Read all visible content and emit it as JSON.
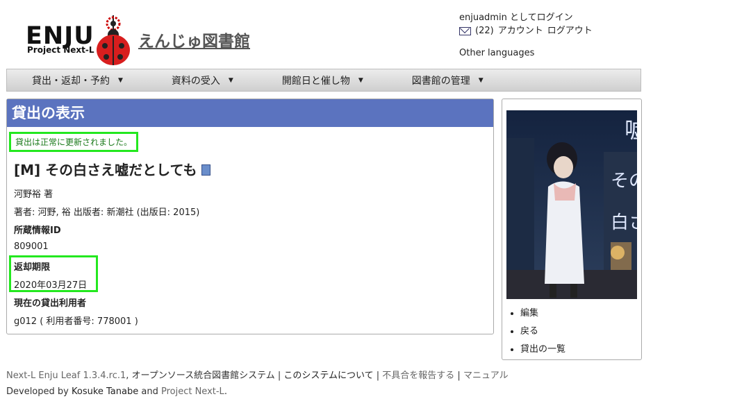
{
  "header": {
    "logo_main": "ENJU",
    "logo_sub": "Project Next-L",
    "site_title": "えんじゅ図書館",
    "login_status": "enjuadmin としてログイン",
    "message_count": "(22)",
    "account_link": "アカウント",
    "logout_link": "ログアウト",
    "other_languages": "Other languages"
  },
  "nav": {
    "items": [
      {
        "label": "貸出・返却・予約"
      },
      {
        "label": "資料の受入"
      },
      {
        "label": "開館日と催し物"
      },
      {
        "label": "図書館の管理"
      }
    ]
  },
  "main": {
    "title": "貸出の表示",
    "notice": "貸出は正常に更新されました。",
    "book_prefix": "[M]",
    "book_title": "その白さえ嘘だとしても",
    "statement": "河野裕 著",
    "creator_label": "著者: ",
    "creator_name": "河野, 裕",
    "publisher_label": "出版者: ",
    "publisher_name": "新潮社",
    "pub_date": "(出版日: 2015)",
    "item_id_label": "所蔵情報ID",
    "item_id": "809001",
    "due_label": "返却期限",
    "due_date": "2020年03月27日",
    "borrower_label": "現在の貸出利用者",
    "borrower_name": "g012",
    "borrower_number": "( 利用者番号: 778001 )"
  },
  "sidebar": {
    "items": [
      {
        "label": "編集"
      },
      {
        "label": "戻る"
      },
      {
        "label": "貸出の一覧"
      }
    ]
  },
  "footer": {
    "software": "Next-L Enju Leaf 1.3.4.rc.1",
    "software_desc": ", オープンソース統合図書館システム | ",
    "about": "このシステムについて",
    "sep1": " | ",
    "report": "不具合を報告する",
    "sep2": " | ",
    "manual": "マニュアル",
    "developed_by": "Developed by ",
    "developer": "Kosuke Tanabe",
    "and": " and ",
    "project": "Project Next-L",
    "period": "."
  },
  "colors": {
    "title_bar": "#5b73bf",
    "highlight": "#23e81f",
    "notice_text": "#1b7a1b"
  }
}
